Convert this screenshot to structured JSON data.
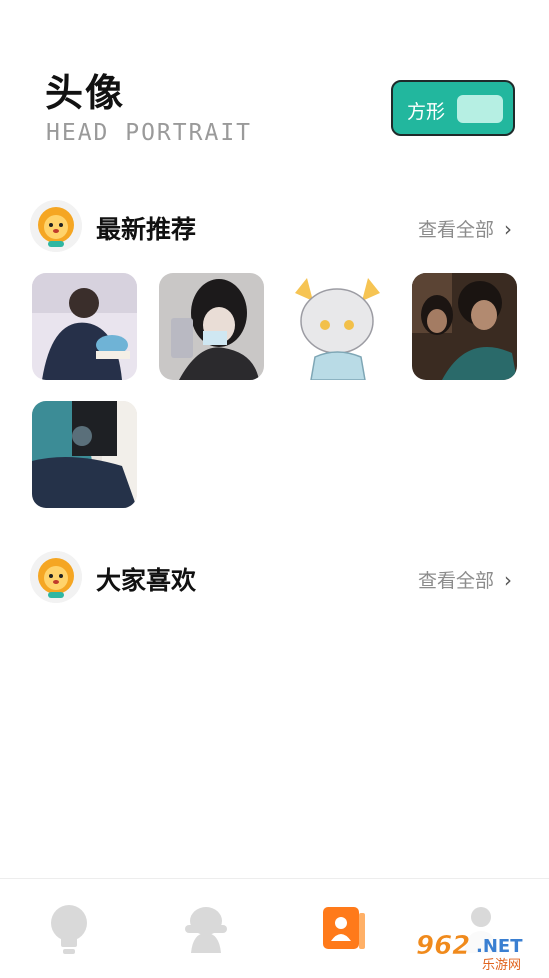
{
  "header": {
    "title": "头像",
    "subtitle": "HEAD PORTRAIT",
    "shape_toggle_label": "方形"
  },
  "sections": [
    {
      "title": "最新推荐",
      "view_all": "查看全部",
      "chevron": "›"
    },
    {
      "title": "大家喜欢",
      "view_all": "查看全部",
      "chevron": "›"
    }
  ],
  "tabbar": {
    "tabs": [
      {
        "icon": "lightbulb-icon",
        "active": false
      },
      {
        "icon": "mascot-icon",
        "active": false
      },
      {
        "icon": "portrait-card-icon",
        "active": true
      },
      {
        "icon": "profile-icon",
        "active": false
      }
    ],
    "active_color": "#ff7a1a",
    "inactive_color": "#d9d9d9"
  },
  "watermark": {
    "number": "962",
    "suffix": ".NET",
    "subtext": "乐游网"
  },
  "colors": {
    "accent": "#22b79e",
    "toggle_knob": "#b6efe3"
  }
}
